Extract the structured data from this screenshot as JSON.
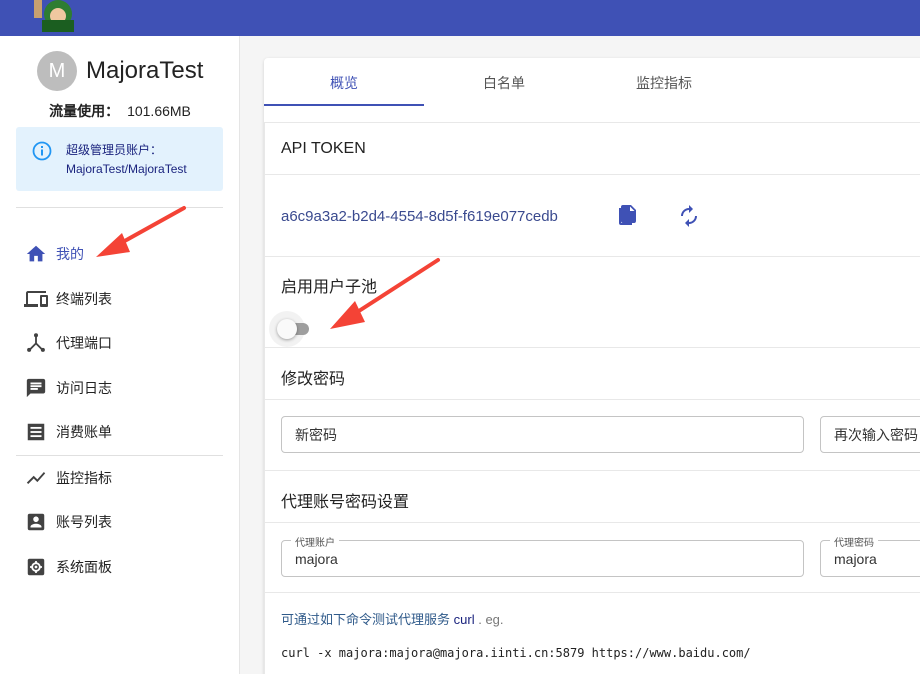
{
  "user": {
    "avatar_initial": "M",
    "name": "MajoraTest",
    "traffic_label": "流量使用：",
    "traffic_value": "101.66MB",
    "info_line1": "超级管理员账户：",
    "info_line2": "MajoraTest/MajoraTest"
  },
  "sidebar": {
    "items": [
      {
        "label": "我的",
        "icon": "home-icon"
      },
      {
        "label": "终端列表",
        "icon": "devices-icon"
      },
      {
        "label": "代理端口",
        "icon": "hub-icon"
      },
      {
        "label": "访问日志",
        "icon": "chat-log-icon"
      },
      {
        "label": "消费账单",
        "icon": "list-bill-icon"
      },
      {
        "label": "监控指标",
        "icon": "trending-icon"
      },
      {
        "label": "账号列表",
        "icon": "account-box-icon"
      },
      {
        "label": "系统面板",
        "icon": "settings-box-icon"
      }
    ]
  },
  "tabs": [
    {
      "label": "概览"
    },
    {
      "label": "白名单"
    },
    {
      "label": "监控指标"
    }
  ],
  "overview": {
    "api_token_title": "API TOKEN",
    "api_token_value": "a6c9a3a2-b2d4-4554-8d5f-f619e077cedb",
    "user_pool_title": "启用用户子池",
    "user_pool_enabled": false,
    "change_password_title": "修改密码",
    "new_password_placeholder": "新密码",
    "confirm_password_placeholder": "再次输入密码",
    "proxy_title": "代理账号密码设置",
    "proxy_account_label": "代理账户",
    "proxy_account_value": "majora",
    "proxy_password_label": "代理密码",
    "proxy_password_value": "majora",
    "hint_prefix": "可通过如下命令测试代理服务",
    "hint_curl": "curl",
    "hint_suffix": ". eg.",
    "command": "curl -x majora:majora@majora.iinti.cn:5879 https://www.baidu.com/"
  },
  "colors": {
    "primary": "#3f51b5",
    "annotation_arrow": "#f44336"
  }
}
